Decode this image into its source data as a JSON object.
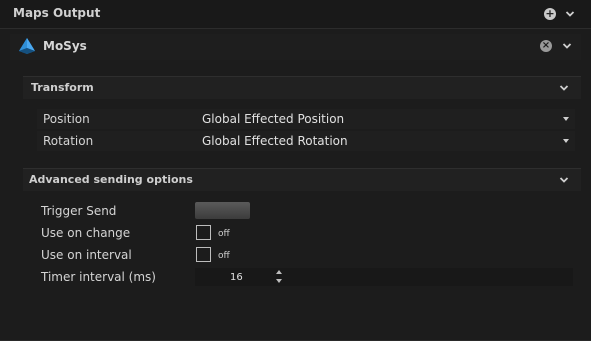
{
  "header": {
    "title": "Maps Output",
    "add_icon": "plus-circle-icon",
    "collapse_icon": "chevron-down-icon"
  },
  "item": {
    "name": "MoSys",
    "logo_icon": "mosys-logo-icon",
    "remove_icon": "close-circle-icon"
  },
  "transform": {
    "title": "Transform",
    "position": {
      "label": "Position",
      "value": "Global Effected Position"
    },
    "rotation": {
      "label": "Rotation",
      "value": "Global Effected Rotation"
    }
  },
  "advanced": {
    "title": "Advanced sending options",
    "trigger_send": {
      "label": "Trigger Send"
    },
    "use_on_change": {
      "label": "Use on change",
      "state": "off"
    },
    "use_on_interval": {
      "label": "Use on interval",
      "state": "off"
    },
    "timer_interval": {
      "label": "Timer interval (ms)",
      "value": "16"
    }
  },
  "colors": {
    "background": "#1c1c1c",
    "text": "#d8d8d8",
    "logo_blue": "#2f8fd8"
  }
}
